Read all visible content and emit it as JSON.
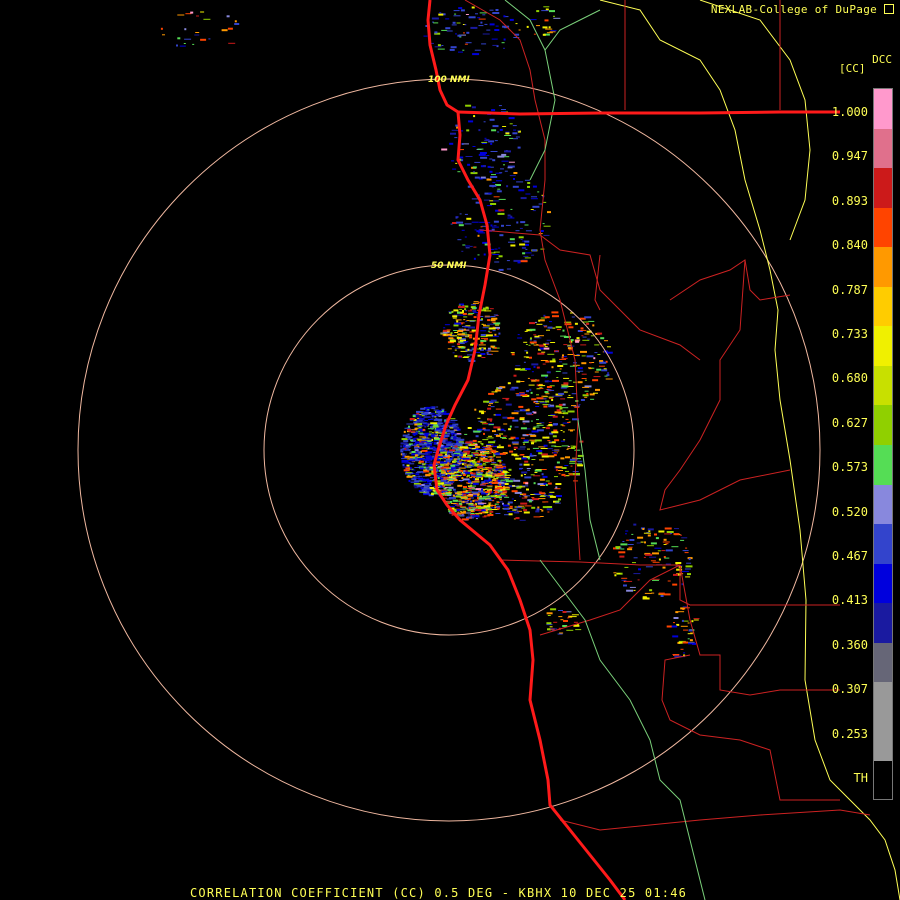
{
  "credit": "NEXLAB-College of DuPage",
  "credit_icon": "external-link-icon",
  "legend": {
    "product": "DCC",
    "unit": "[CC]",
    "ticks": [
      "1.000",
      "0.947",
      "0.893",
      "0.840",
      "0.787",
      "0.733",
      "0.680",
      "0.627",
      "0.573",
      "0.520",
      "0.467",
      "0.413",
      "0.360",
      "0.307",
      "0.253",
      "TH"
    ],
    "colors": [
      "#ff99cc",
      "#e0708c",
      "#cc1a1a",
      "#ff4400",
      "#ff9900",
      "#ffcc00",
      "#f0f000",
      "#c8e000",
      "#90d000",
      "#55dd55",
      "#8888dd",
      "#3344cc",
      "#0000dd",
      "#1a1aa0",
      "#666677",
      "#999999",
      "#999999",
      "#000000"
    ]
  },
  "range_rings": {
    "inner_label": "50 NMI",
    "outer_label": "100 NMI",
    "ring_color": "#f0b8a0"
  },
  "boundary_colors": {
    "coast": "#ff1a1a",
    "county": "#cc2222",
    "state": "#ffff55",
    "river": "#7ad07a"
  },
  "footer": "CORRELATION COEFFICIENT (CC) 0.5 DEG - KBHX 10 DEC 25 01:46"
}
